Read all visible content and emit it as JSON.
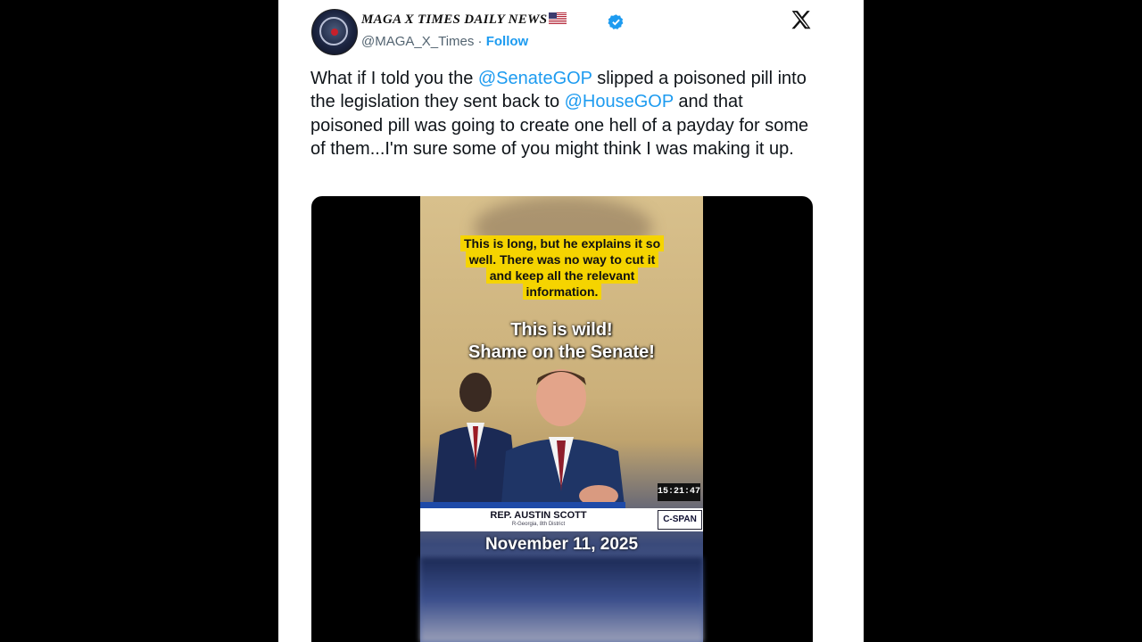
{
  "account": {
    "display_name": "MAGA X TIMES DAILY NEWS",
    "handle": "@MAGA_X_Times",
    "separator": "·",
    "follow_label": "Follow"
  },
  "tweet": {
    "p1": "What if I told you the ",
    "mention1": "@SenateGOP",
    "p2": " slipped a poisoned pill into the legislation they sent back to ",
    "mention2": "@HouseGOP",
    "p3": " and that poisoned pill was going to create one hell of a payday for some of them...I'm sure some of you might think I was making it up."
  },
  "video": {
    "caption": "This is long, but he explains it so well. There was no way to cut it and keep all the relevant information.",
    "headline_line1": "This is wild!",
    "headline_line2": "Shame on the Senate!",
    "lower_third_name": "REP. AUSTIN SCOTT",
    "lower_third_sub": "R-Georgia, 8th District",
    "network": "C-SPAN",
    "clock": "15:21:47",
    "date": "November 11, 2025"
  },
  "colors": {
    "link": "#1d9bf0",
    "highlight": "#f5d400",
    "verified": "#1d9bf0"
  }
}
